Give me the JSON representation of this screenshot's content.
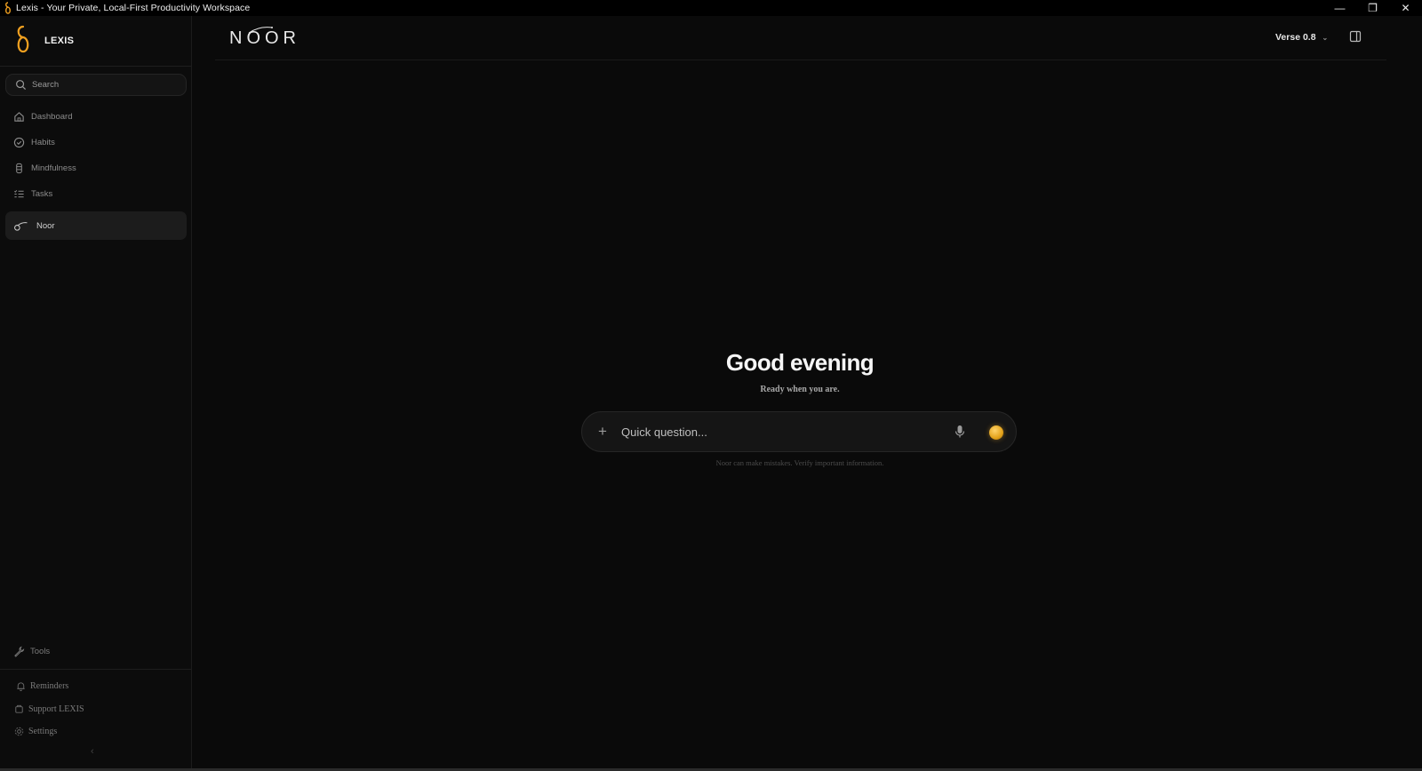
{
  "window": {
    "title": "Lexis - Your Private, Local-First Productivity Workspace",
    "controls": {
      "minimize": "—",
      "restore": "❐",
      "close": "✕"
    }
  },
  "brand": {
    "name": "LEXIS",
    "accent_color": "#f0a020"
  },
  "search": {
    "placeholder": "Search"
  },
  "nav": {
    "items": [
      {
        "label": "Dashboard",
        "icon": "home-icon"
      },
      {
        "label": "Habits",
        "icon": "check-circle-icon"
      },
      {
        "label": "Mindfulness",
        "icon": "mindfulness-icon"
      },
      {
        "label": "Tasks",
        "icon": "list-icon"
      },
      {
        "label": "Noor",
        "icon": "noor-icon",
        "active": true
      }
    ]
  },
  "footer": {
    "tools": "Tools",
    "reminders": "Reminders",
    "support": "Support LEXIS",
    "settings": "Settings",
    "collapse": "‹"
  },
  "header": {
    "wordmark": "NOOR",
    "model": "Verse 0.8"
  },
  "main": {
    "greeting": "Good evening",
    "subgreeting": "Ready when you are.",
    "prompt_placeholder": "Quick question...",
    "disclaimer": "Noor can make mistakes. Verify important information."
  },
  "colors": {
    "background": "#0a0a0a",
    "sidebar": "#0c0c0c",
    "orb": "#e3a21a"
  }
}
